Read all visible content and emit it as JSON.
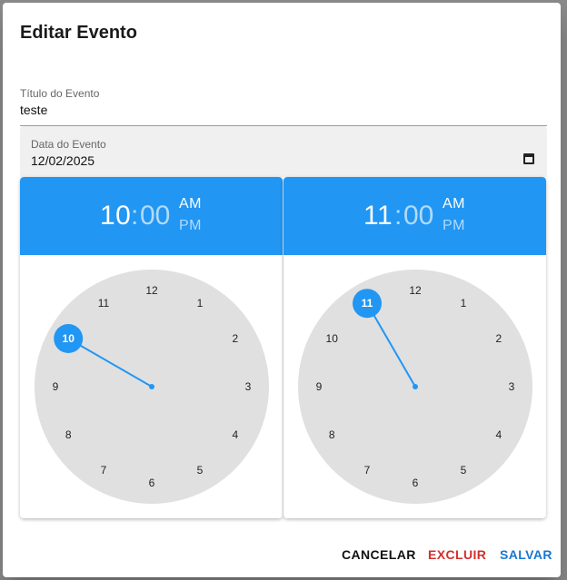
{
  "dialog": {
    "title": "Editar Evento",
    "event_title": {
      "label": "Título do Evento",
      "value": "teste"
    },
    "event_date": {
      "label": "Data do Evento",
      "value": "12/02/2025"
    }
  },
  "start_picker": {
    "hour": "10",
    "colon": ":",
    "minute": "00",
    "am": "AM",
    "pm": "PM",
    "selected_period": "AM",
    "selected_hour": 10
  },
  "end_picker": {
    "hour": "11",
    "colon": ":",
    "minute": "00",
    "am": "AM",
    "pm": "PM",
    "selected_period": "AM",
    "selected_hour": 11
  },
  "clock_numbers": [
    "12",
    "1",
    "2",
    "3",
    "4",
    "5",
    "6",
    "7",
    "8",
    "9",
    "10",
    "11"
  ],
  "actions": {
    "cancel": "CANCELAR",
    "delete": "EXCLUIR",
    "save": "SALVAR"
  },
  "colors": {
    "accent": "#2196f3",
    "danger": "#d32f2f",
    "save": "#1976d2",
    "clock_face": "#e0e0e0"
  }
}
